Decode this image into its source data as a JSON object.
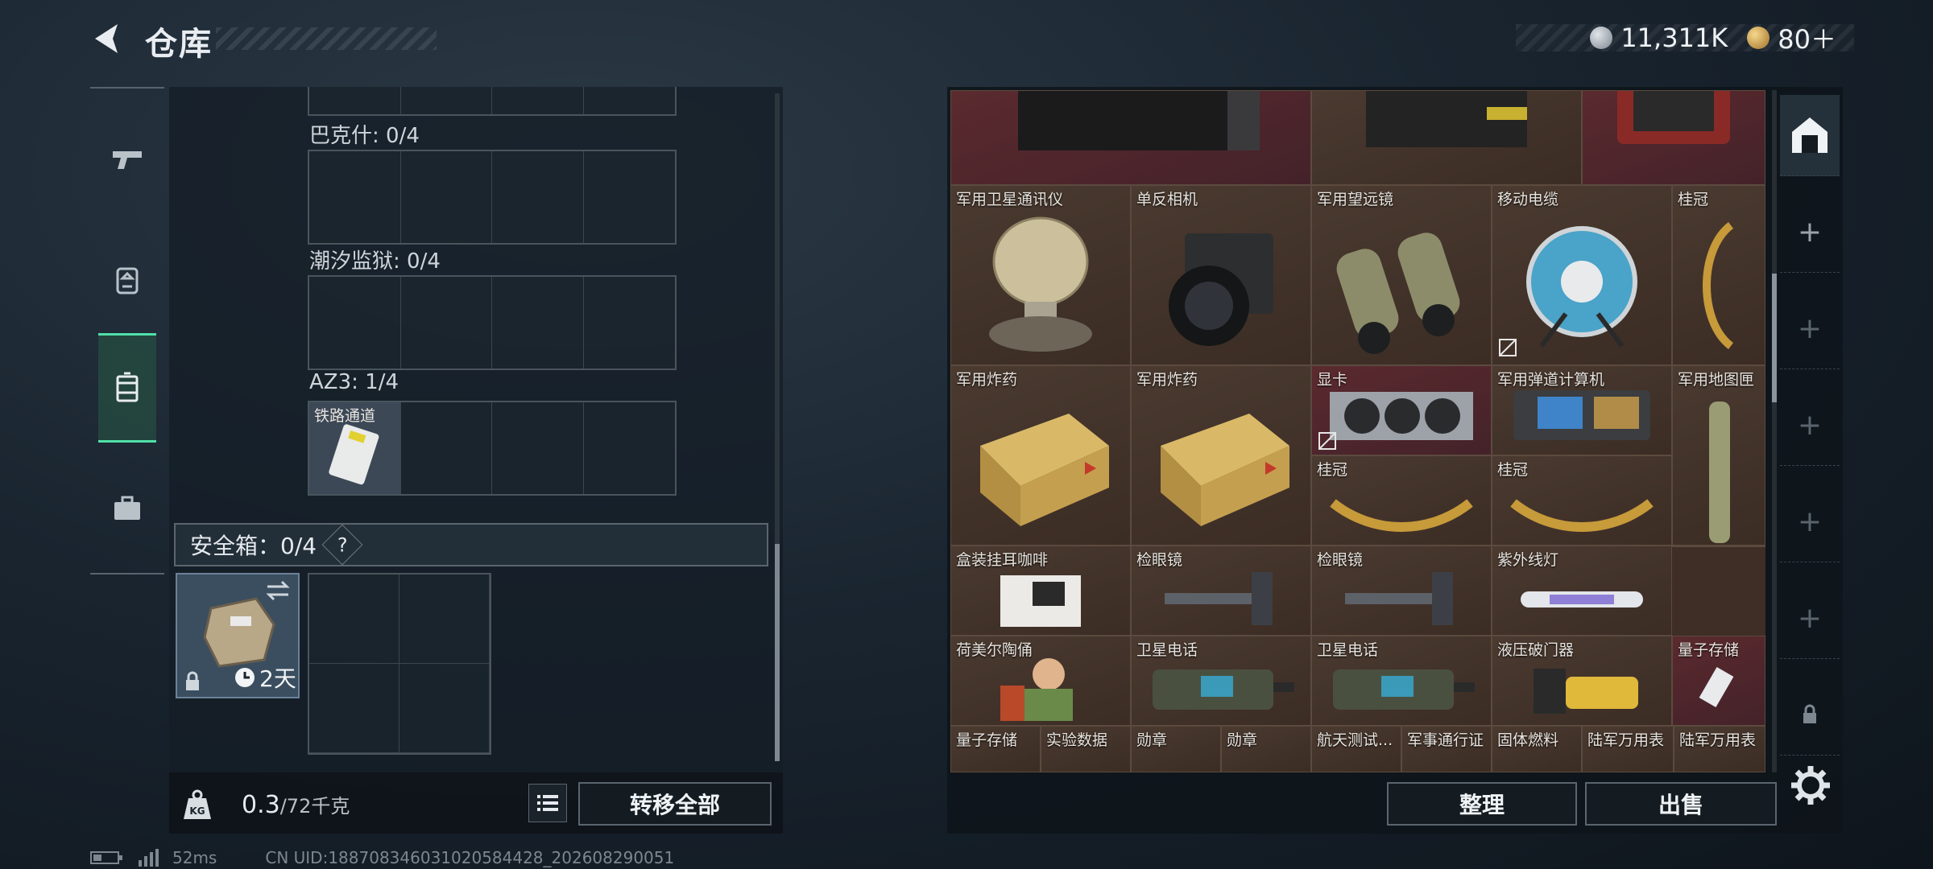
{
  "header": {
    "title": "仓库",
    "currencies": [
      {
        "icon": "silver-coin-icon",
        "value": "11,311K",
        "color": "#9aa3ab"
      },
      {
        "icon": "gold-coin-icon",
        "value": "80＋",
        "color": "#d2a24a"
      }
    ]
  },
  "left_nav": {
    "items": [
      {
        "icon": "pistol-icon",
        "label": "weapons"
      },
      {
        "icon": "backpack-icon",
        "label": "gear"
      },
      {
        "icon": "case-icon",
        "label": "containers"
      },
      {
        "icon": "briefcase-icon",
        "label": "collections"
      }
    ],
    "active_index": 2,
    "accent": "#4fe0a8"
  },
  "containers": [
    {
      "label": "巴克什: 0/4"
    },
    {
      "label": "潮汐监狱: 0/4"
    },
    {
      "label": "AZ3: 1/4",
      "first_item": "铁路通道"
    }
  ],
  "safe_box": {
    "label": "安全箱：0/4",
    "help": "?",
    "timer": "2天"
  },
  "footer_left": {
    "weight_value": "0.3",
    "weight_unit": "/72千克",
    "transfer_all": "转移全部"
  },
  "stash_items": [
    {
      "name": "",
      "style": "red"
    },
    {
      "name": "",
      "style": "normal"
    },
    {
      "name": "",
      "style": "red"
    },
    {
      "name": "军用卫星通讯仪"
    },
    {
      "name": "单反相机"
    },
    {
      "name": "军用望远镜"
    },
    {
      "name": "移动电缆"
    },
    {
      "name": "桂冠"
    },
    {
      "name": "军用炸药"
    },
    {
      "name": "军用炸药"
    },
    {
      "name": "显卡"
    },
    {
      "name": "军用弹道计算机"
    },
    {
      "name": "军用地图匣"
    },
    {
      "name": "桂冠"
    },
    {
      "name": "桂冠"
    },
    {
      "name": "盒装挂耳咖啡"
    },
    {
      "name": "检眼镜"
    },
    {
      "name": "检眼镜"
    },
    {
      "name": "紫外线灯"
    },
    {
      "name": "荷美尔陶俑"
    },
    {
      "name": "卫星电话"
    },
    {
      "name": "卫星电话"
    },
    {
      "name": "液压破门器"
    },
    {
      "name": "量子存储"
    },
    {
      "name": "量子存储"
    },
    {
      "name": "实验数据"
    },
    {
      "name": "勋章"
    },
    {
      "name": "勋章"
    },
    {
      "name": "航天测试..."
    },
    {
      "name": "军事通行证"
    },
    {
      "name": "固体燃料"
    },
    {
      "name": "陆军万用表"
    },
    {
      "name": "陆军万用表"
    }
  ],
  "footer_right": {
    "sort": "整理",
    "sell": "出售"
  },
  "status": {
    "ping": "52ms",
    "uid": "CN UID:188708346031020584428_202608290051"
  }
}
